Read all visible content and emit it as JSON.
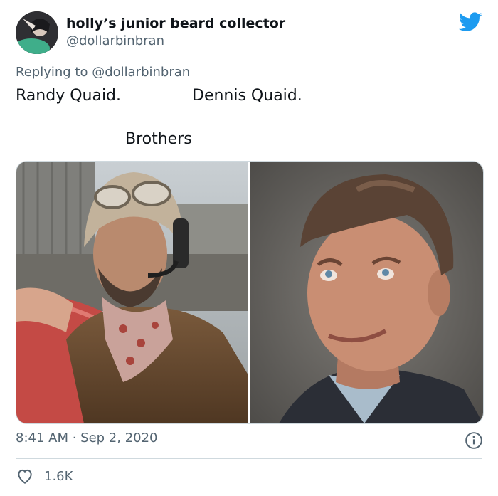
{
  "author": {
    "display_name": "holly’s junior beard collector",
    "handle": "@dollarbinbran",
    "avatar_icon": "avatar"
  },
  "reply": {
    "prefix": "Replying to ",
    "mention": "@dollarbinbran"
  },
  "tweet": {
    "line1_left": "Randy Quaid.",
    "line1_right": "Dennis Quaid.",
    "line2": "Brothers"
  },
  "media": {
    "left_photo": "photo-man-with-goggles-helmet",
    "right_photo": "photo-smiling-man-portrait"
  },
  "meta": {
    "timestamp": "8:41 AM · Sep 2, 2020"
  },
  "engagement": {
    "likes": "1.6K"
  },
  "colors": {
    "brand": "#1d9bf0",
    "text": "#0f1419",
    "secondary": "#536471",
    "border": "#cfd9de"
  }
}
